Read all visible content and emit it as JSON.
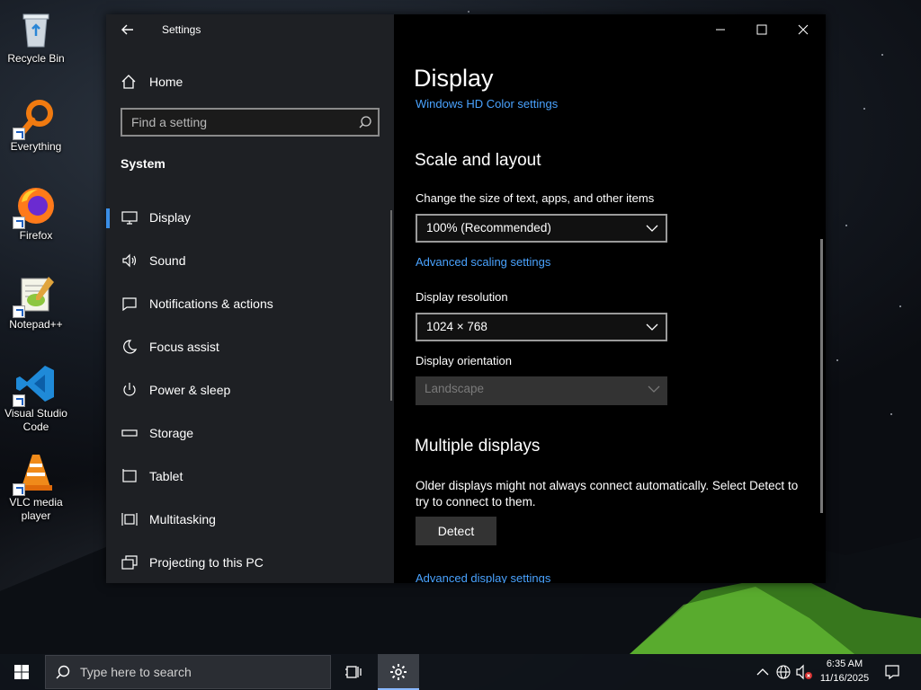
{
  "desktop": {
    "icons": [
      {
        "label": "Recycle Bin",
        "icon": "recycle-bin-icon"
      },
      {
        "label": "Everything",
        "icon": "everything-search-icon"
      },
      {
        "label": "Firefox",
        "icon": "firefox-icon"
      },
      {
        "label": "Notepad++",
        "icon": "notepad-plus-plus-icon"
      },
      {
        "label": "Visual Studio Code",
        "icon": "vscode-icon"
      },
      {
        "label": "VLC media player",
        "icon": "vlc-icon"
      }
    ]
  },
  "window": {
    "title": "Settings",
    "sidebar": {
      "home_label": "Home",
      "search_placeholder": "Find a setting",
      "section_label": "System",
      "items": [
        {
          "label": "Display",
          "icon": "monitor-icon",
          "active": true
        },
        {
          "label": "Sound",
          "icon": "speaker-icon"
        },
        {
          "label": "Notifications & actions",
          "icon": "notification-icon"
        },
        {
          "label": "Focus assist",
          "icon": "moon-icon"
        },
        {
          "label": "Power & sleep",
          "icon": "power-icon"
        },
        {
          "label": "Storage",
          "icon": "storage-icon"
        },
        {
          "label": "Tablet",
          "icon": "tablet-icon"
        },
        {
          "label": "Multitasking",
          "icon": "multitasking-icon"
        },
        {
          "label": "Projecting to this PC",
          "icon": "projecting-icon"
        }
      ]
    },
    "main": {
      "title": "Display",
      "hd_color_link": "Windows HD Color settings",
      "scale_heading": "Scale and layout",
      "scale_label": "Change the size of text, apps, and other items",
      "scale_value": "100% (Recommended)",
      "advanced_scaling_link": "Advanced scaling settings",
      "resolution_label": "Display resolution",
      "resolution_value": "1024 × 768",
      "orientation_label": "Display orientation",
      "orientation_value": "Landscape",
      "multiple_heading": "Multiple displays",
      "multiple_desc": "Older displays might not always connect automatically. Select Detect to try to connect to them.",
      "detect_button": "Detect",
      "advanced_display_link": "Advanced display settings"
    }
  },
  "taskbar": {
    "search_placeholder": "Type here to search",
    "time": "6:35 AM",
    "date": "11/16/2025"
  },
  "colors": {
    "accent": "#3a8ee6",
    "link": "#4aa3ff",
    "sidebar_bg": "#202226",
    "main_bg": "#000000"
  }
}
